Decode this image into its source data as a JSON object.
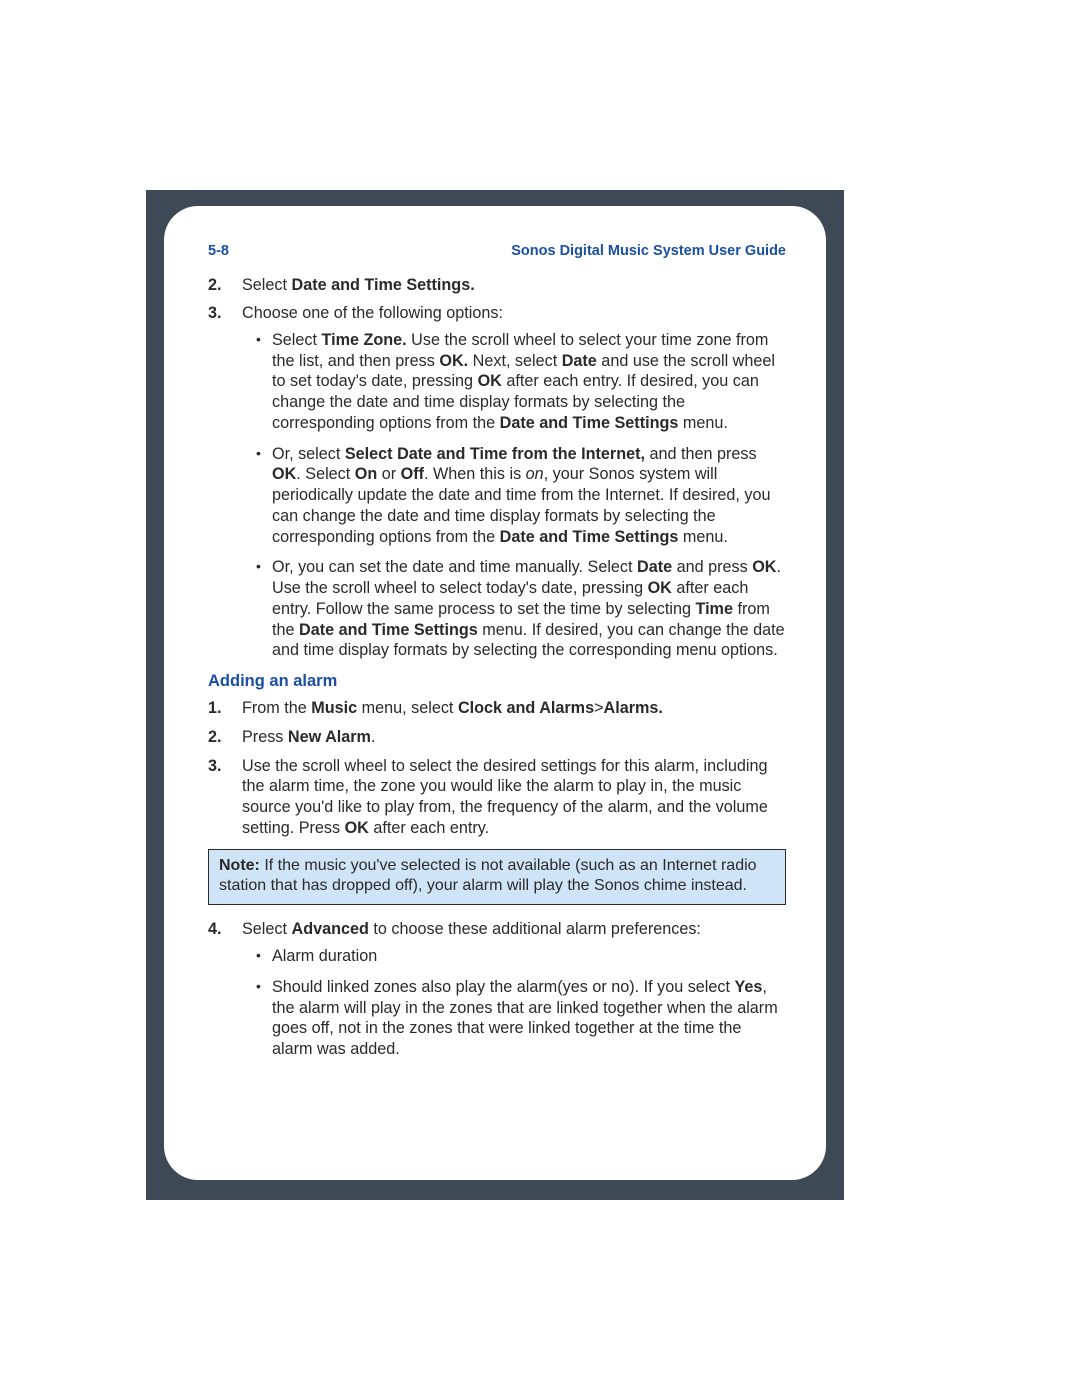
{
  "header": {
    "page_ref": "5-8",
    "title": "Sonos Digital Music System User Guide"
  },
  "list_a": {
    "item2": {
      "num": "2.",
      "t1": "Select ",
      "b1": "Date and Time Settings."
    },
    "item3": {
      "num": "3.",
      "t1": "Choose one of the following options:",
      "sub": {
        "a": {
          "t1": "Select ",
          "b1": "Time Zone.",
          "t2": " Use the scroll wheel to select your time zone from the list, and then press ",
          "b2": "OK.",
          "t3": " Next, select ",
          "b3": "Date",
          "t4": " and use the scroll wheel to set today's date, pressing ",
          "b4": "OK",
          "t5": " after each entry. If desired, you can change the date and time display formats by selecting the corresponding options from the ",
          "b5": "Date and Time Settings",
          "t6": " menu."
        },
        "b": {
          "t1": "Or, select ",
          "b1": "Select Date and Time from the Internet,",
          "t2": " and then press ",
          "b2": "OK",
          "t3": ". Select ",
          "b3": "On",
          "t4": " or ",
          "b4": "Off",
          "t5": ". When this is ",
          "i1": "on",
          "t6": ", your Sonos system will periodically update the date and time from the Internet. If desired, you can change the date and time display formats by selecting the corresponding options from the ",
          "b5": "Date and Time Settings",
          "t7": " menu."
        },
        "c": {
          "t1": "Or, you can set the date and time manually. Select ",
          "b1": "Date",
          "t2": " and press ",
          "b2": "OK",
          "t3": ". Use the scroll wheel to select today's date, pressing ",
          "b3": "OK",
          "t4": " after each entry. Follow the same process to set the time by selecting ",
          "b4": "Time",
          "t5": " from the ",
          "b5": "Date and Time Settings",
          "t6": " menu. If desired, you can change the date and time display formats by selecting the corresponding menu options."
        }
      }
    }
  },
  "subheading": "Adding an alarm",
  "list_b": {
    "item1": {
      "num": "1.",
      "t1": "From the ",
      "b1": "Music",
      "t2": " menu, select ",
      "b2": "Clock and Alarms",
      "sep": ">",
      "b3": "Alarms."
    },
    "item2": {
      "num": "2.",
      "t1": "Press ",
      "b1": "New Alarm",
      "t2": "."
    },
    "item3": {
      "num": "3.",
      "t1": "Use the scroll wheel to select the desired settings for this alarm, including the alarm time, the zone you would like the alarm to play in, the music source you'd like to play from, the frequency of the alarm, and the volume setting. Press ",
      "b1": "OK",
      "t2": " after each entry."
    },
    "item4": {
      "num": "4.",
      "t1": "Select ",
      "b1": "Advanced",
      "t2": " to choose these additional alarm preferences:",
      "sub": {
        "a": {
          "t1": "Alarm duration"
        },
        "b": {
          "t1": "Should linked zones also play the alarm(yes or no). If you select ",
          "b1": "Yes",
          "t2": ", the alarm will play in the zones that are linked together when the alarm goes off, not in the zones that were linked together at the time the alarm was added."
        }
      }
    }
  },
  "note": {
    "label": "Note:",
    "text": "  If the music you've selected is not available (such as an Internet radio station that has dropped off), your alarm will play the Sonos chime instead."
  }
}
